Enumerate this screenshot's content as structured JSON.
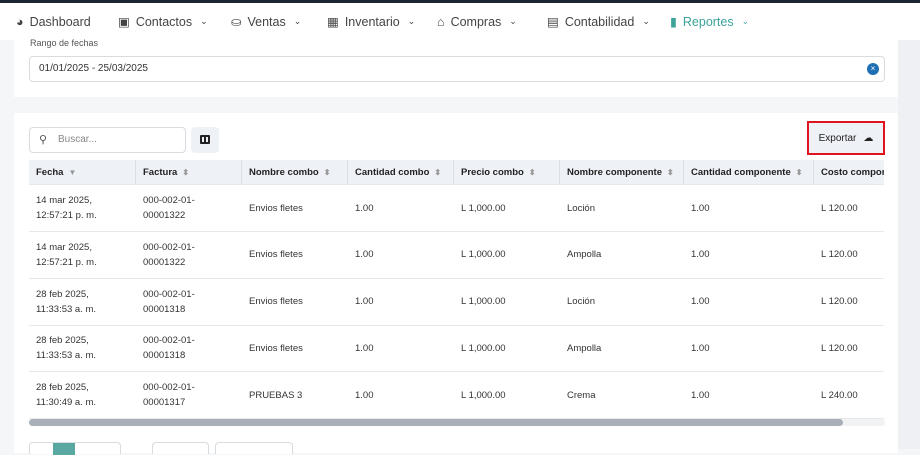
{
  "nav": {
    "items": [
      {
        "label": "Dashboard",
        "icon": "dashboard-icon"
      },
      {
        "label": "Contactos",
        "icon": "contacts-icon"
      },
      {
        "label": "Ventas",
        "icon": "sales-icon"
      },
      {
        "label": "Inventario",
        "icon": "inventory-icon"
      },
      {
        "label": "Compras",
        "icon": "store-icon"
      },
      {
        "label": "Contabilidad",
        "icon": "calculator-icon"
      },
      {
        "label": "Reportes",
        "icon": "bar-chart-icon"
      }
    ],
    "active": "Reportes",
    "accent": "#3aa39a"
  },
  "filter": {
    "label": "Rango de fechas",
    "value": "01/01/2025  - 25/03/2025"
  },
  "toolbar": {
    "search_placeholder": "Buscar...",
    "export_label": "Exportar"
  },
  "table": {
    "columns": [
      "Fecha",
      "Factura",
      "Nombre combo",
      "Cantidad combo",
      "Precio combo",
      "Nombre componente",
      "Cantidad componente",
      "Costo compon"
    ],
    "rows": [
      [
        "14 mar 2025, 12:57:21 p. m.",
        "000-002-01-00001322",
        "Envios fletes",
        "1.00",
        "L 1,000.00",
        "Loción",
        "1.00",
        "L 120.00"
      ],
      [
        "14 mar 2025, 12:57:21 p. m.",
        "000-002-01-00001322",
        "Envios fletes",
        "1.00",
        "L 1,000.00",
        "Ampolla",
        "1.00",
        "L 120.00"
      ],
      [
        "28 feb 2025, 11:33:53 a. m.",
        "000-002-01-00001318",
        "Envios fletes",
        "1.00",
        "L 1,000.00",
        "Loción",
        "1.00",
        "L 120.00"
      ],
      [
        "28 feb 2025, 11:33:53 a. m.",
        "000-002-01-00001318",
        "Envios fletes",
        "1.00",
        "L 1,000.00",
        "Ampolla",
        "1.00",
        "L 120.00"
      ],
      [
        "28 feb 2025, 11:30:49 a. m.",
        "000-002-01-00001317",
        "PRUEBAS 3",
        "1.00",
        "L 1,000.00",
        "Crema",
        "1.00",
        "L 240.00"
      ]
    ]
  }
}
